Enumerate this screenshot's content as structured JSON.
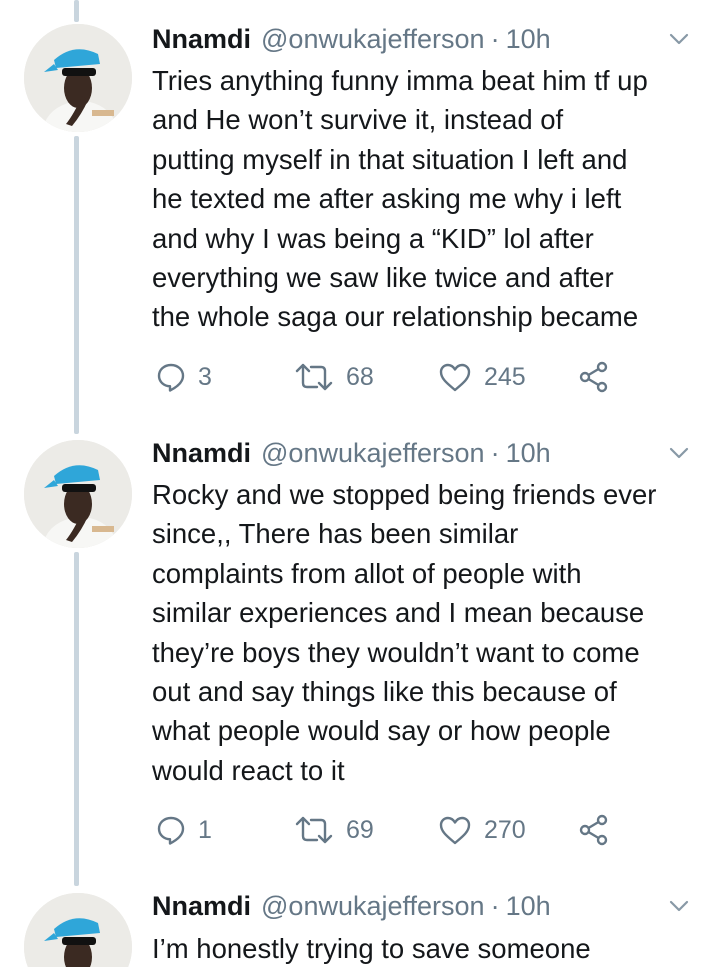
{
  "tweets": [
    {
      "name": "Nnamdi",
      "handle": "@onwukajefferson",
      "separator": "·",
      "time": "10h",
      "text": "Tries anything funny imma beat him tf up\nand He won’t survive it, instead of\nputting myself in that situation I left and\nhe texted me after asking me why i left\nand why I was being a “KID” lol after\neverything we saw like twice and after\nthe whole saga our relationship became",
      "replies": "3",
      "retweets": "68",
      "likes": "245"
    },
    {
      "name": "Nnamdi",
      "handle": "@onwukajefferson",
      "separator": "·",
      "time": "10h",
      "text": "Rocky and we stopped being friends ever\nsince,, There has been similar\ncomplaints from allot of people with\nsimilar experiences and I mean because\nthey’re boys they wouldn’t want to come\nout and say things like this because of\nwhat people would say or how people\nwould react to it",
      "replies": "1",
      "retweets": "69",
      "likes": "270"
    },
    {
      "name": "Nnamdi",
      "handle": "@onwukajefferson",
      "separator": "·",
      "time": "10h",
      "text": "I’m honestly trying to save someone"
    }
  ],
  "colors": {
    "text": "#14171a",
    "muted": "#657786",
    "thread": "#c9d5de",
    "cap": "#2fa6d9"
  },
  "icons": [
    "reply-icon",
    "retweet-icon",
    "like-icon",
    "share-icon",
    "chevron-down-icon"
  ]
}
